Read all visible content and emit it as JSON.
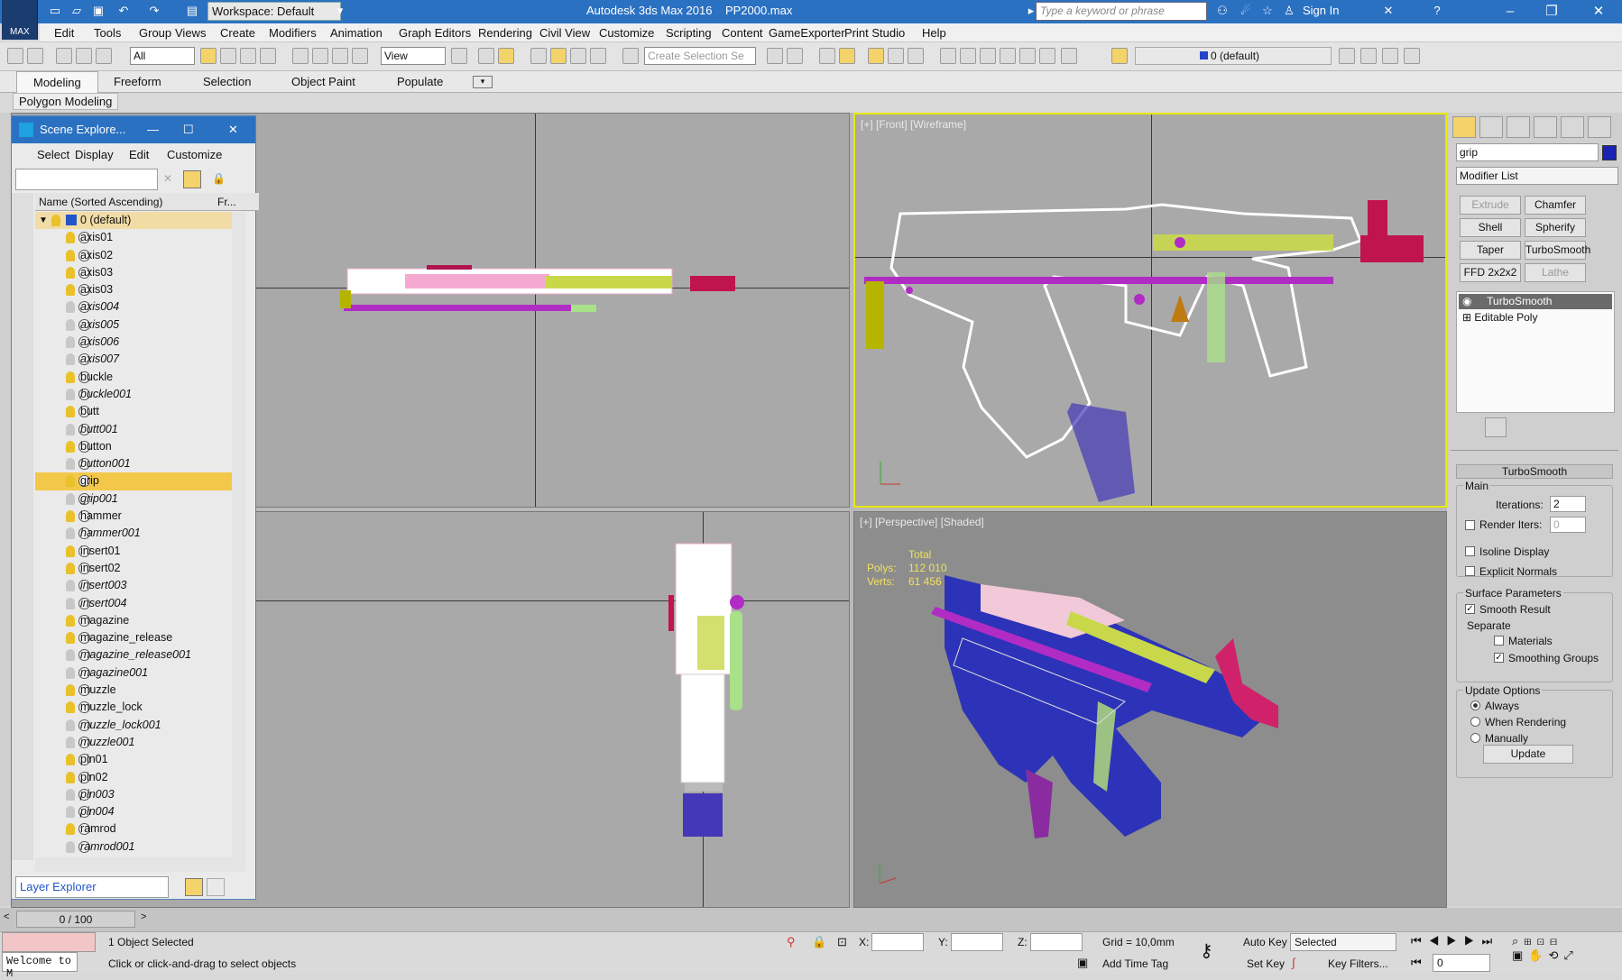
{
  "app": {
    "title": "Autodesk 3ds Max 2016",
    "file": "PP2000.max",
    "logo_text": "MAX",
    "workspace": "Workspace: Default",
    "search_placeholder": "Type a keyword or phrase",
    "sign_in": "Sign In"
  },
  "menu": [
    "Edit",
    "Tools",
    "Group",
    "Views",
    "Create",
    "Modifiers",
    "Animation",
    "Graph Editors",
    "Rendering",
    "Civil View",
    "Customize",
    "Scripting",
    "Content",
    "GameExporter",
    "Print Studio",
    "Help"
  ],
  "toolbar": {
    "filter": "All",
    "ref_coord": "View",
    "selection_set_placeholder": "Create Selection Se",
    "layer": "0 (default)"
  },
  "ribbon": {
    "tabs": [
      "Modeling",
      "Freeform",
      "Selection",
      "Object Paint",
      "Populate"
    ],
    "active_tab": "Modeling",
    "panel": "Polygon Modeling"
  },
  "scene_explorer": {
    "title": "Scene Explore...",
    "menu": [
      "Select",
      "Display",
      "Edit",
      "Customize"
    ],
    "col_name": "Name (Sorted Ascending)",
    "col_frozen": "Fr...",
    "layer_row": "0 (default)",
    "footer": "Layer Explorer",
    "rows": [
      {
        "name": "axis01",
        "italic": false,
        "lit": true
      },
      {
        "name": "axis02",
        "italic": false,
        "lit": true
      },
      {
        "name": "axis03",
        "italic": false,
        "lit": true
      },
      {
        "name": "axis03",
        "italic": false,
        "lit": true
      },
      {
        "name": "axis004",
        "italic": true,
        "lit": false
      },
      {
        "name": "axis005",
        "italic": true,
        "lit": false
      },
      {
        "name": "axis006",
        "italic": true,
        "lit": false
      },
      {
        "name": "axis007",
        "italic": true,
        "lit": false
      },
      {
        "name": "buckle",
        "italic": false,
        "lit": true
      },
      {
        "name": "buckle001",
        "italic": true,
        "lit": false
      },
      {
        "name": "butt",
        "italic": false,
        "lit": true
      },
      {
        "name": "butt001",
        "italic": true,
        "lit": false
      },
      {
        "name": "button",
        "italic": false,
        "lit": true
      },
      {
        "name": "button001",
        "italic": true,
        "lit": false
      },
      {
        "name": "grip",
        "italic": false,
        "lit": true,
        "selected": true
      },
      {
        "name": "grip001",
        "italic": true,
        "lit": false
      },
      {
        "name": "hammer",
        "italic": false,
        "lit": true
      },
      {
        "name": "hammer001",
        "italic": true,
        "lit": false
      },
      {
        "name": "insert01",
        "italic": false,
        "lit": true
      },
      {
        "name": "insert02",
        "italic": false,
        "lit": true
      },
      {
        "name": "insert003",
        "italic": true,
        "lit": false
      },
      {
        "name": "insert004",
        "italic": true,
        "lit": false
      },
      {
        "name": "magazine",
        "italic": false,
        "lit": true
      },
      {
        "name": "magazine_release",
        "italic": false,
        "lit": true
      },
      {
        "name": "magazine_release001",
        "italic": true,
        "lit": false
      },
      {
        "name": "magazine001",
        "italic": true,
        "lit": false
      },
      {
        "name": "muzzle",
        "italic": false,
        "lit": true
      },
      {
        "name": "muzzle_lock",
        "italic": false,
        "lit": true
      },
      {
        "name": "muzzle_lock001",
        "italic": true,
        "lit": false
      },
      {
        "name": "muzzle001",
        "italic": true,
        "lit": false
      },
      {
        "name": "pin01",
        "italic": false,
        "lit": true
      },
      {
        "name": "pin02",
        "italic": false,
        "lit": true
      },
      {
        "name": "pin003",
        "italic": true,
        "lit": false
      },
      {
        "name": "pin004",
        "italic": true,
        "lit": false
      },
      {
        "name": "ramrod",
        "italic": false,
        "lit": true
      },
      {
        "name": "ramrod001",
        "italic": true,
        "lit": false
      }
    ]
  },
  "viewports": {
    "front_label": "[+] [Front] [Wireframe]",
    "persp_label": "[+] [Perspective] [Shaded]",
    "stats_total": "Total",
    "stats_polys_label": "Polys:",
    "stats_polys": "112 010",
    "stats_verts_label": "Verts:",
    "stats_verts": "61 456"
  },
  "command_panel": {
    "object_name": "grip",
    "modifier_list": "Modifier List",
    "buttons": [
      "Extrude",
      "Chamfer",
      "Shell",
      "Spherify",
      "Taper",
      "TurboSmooth",
      "FFD 2x2x2",
      "Lathe"
    ],
    "stack": [
      "TurboSmooth",
      "Editable Poly"
    ],
    "rollout_title": "TurboSmooth",
    "main": "Main",
    "iterations_label": "Iterations:",
    "iterations": "2",
    "render_iters_label": "Render Iters:",
    "render_iters": "0",
    "isoline": "Isoline Display",
    "explicit_normals": "Explicit Normals",
    "surface_params": "Surface Parameters",
    "smooth_result": "Smooth Result",
    "separate": "Separate",
    "materials": "Materials",
    "smoothing_groups": "Smoothing Groups",
    "update_options": "Update Options",
    "always": "Always",
    "when_rendering": "When Rendering",
    "manually": "Manually",
    "update": "Update"
  },
  "status": {
    "frame": "0 / 100",
    "maxscript": "Welcome to M",
    "selected": "1 Object Selected",
    "prompt": "Click or click-and-drag to select objects",
    "x_label": "X:",
    "y_label": "Y:",
    "z_label": "Z:",
    "grid": "Grid = 10,0mm",
    "add_time_tag": "Add Time Tag",
    "auto_key": "Auto Key",
    "set_key": "Set Key",
    "selected_dropdown": "Selected",
    "key_filters": "Key Filters...",
    "current_frame": "0"
  }
}
